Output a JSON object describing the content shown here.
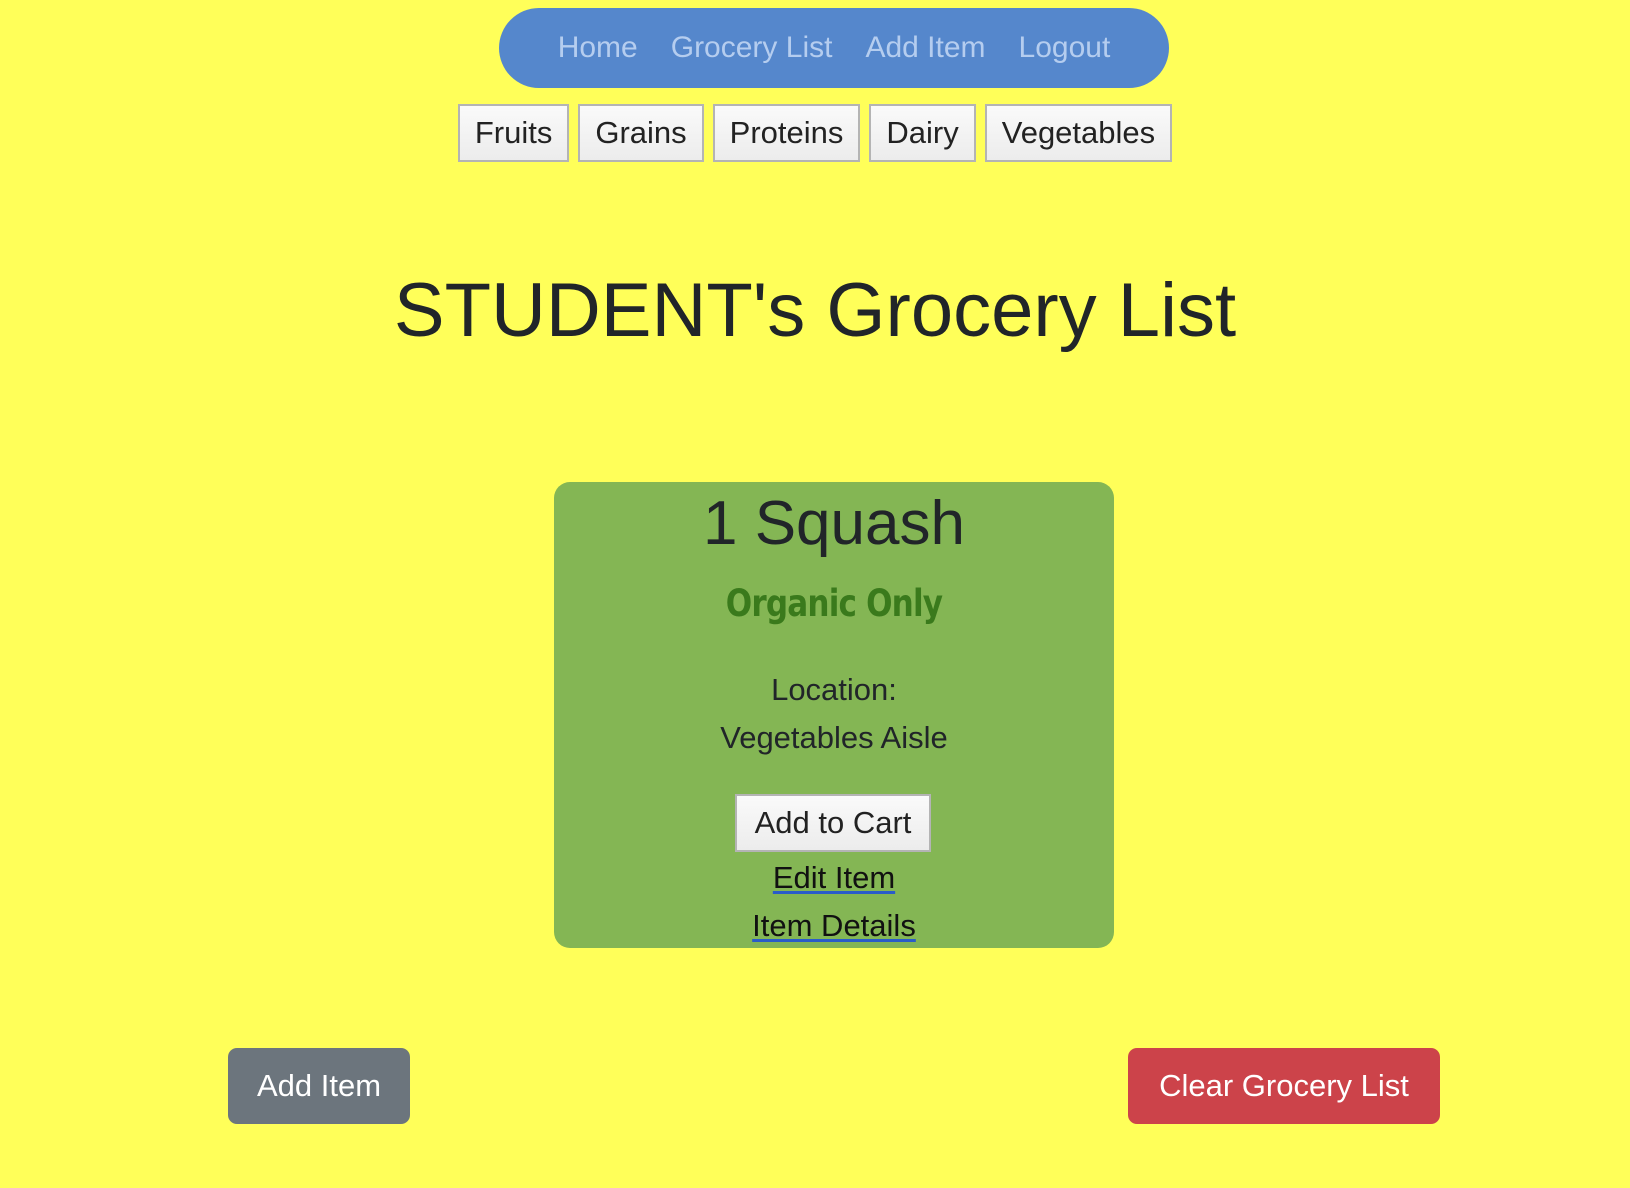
{
  "nav": {
    "links": [
      {
        "label": "Home"
      },
      {
        "label": "Grocery List"
      },
      {
        "label": "Add Item"
      },
      {
        "label": "Logout"
      }
    ]
  },
  "categories": [
    "Fruits",
    "Grains",
    "Proteins",
    "Dairy",
    "Vegetables"
  ],
  "page_title": "STUDENT's Grocery List",
  "item": {
    "name": "1 Squash",
    "note": "Organic Only",
    "location_label": "Location:",
    "location": "Vegetables Aisle",
    "add_to_cart_label": "Add to Cart",
    "edit_label": "Edit Item",
    "details_label": "Item Details"
  },
  "actions": {
    "add_item_label": "Add Item",
    "clear_label": "Clear Grocery List"
  },
  "colors": {
    "background": "#ffff59",
    "navbar": "#5587cc",
    "card": "#84b654",
    "note": "#3a7a1c",
    "secondary_button": "#6c757d",
    "danger_button": "#cc434a"
  }
}
